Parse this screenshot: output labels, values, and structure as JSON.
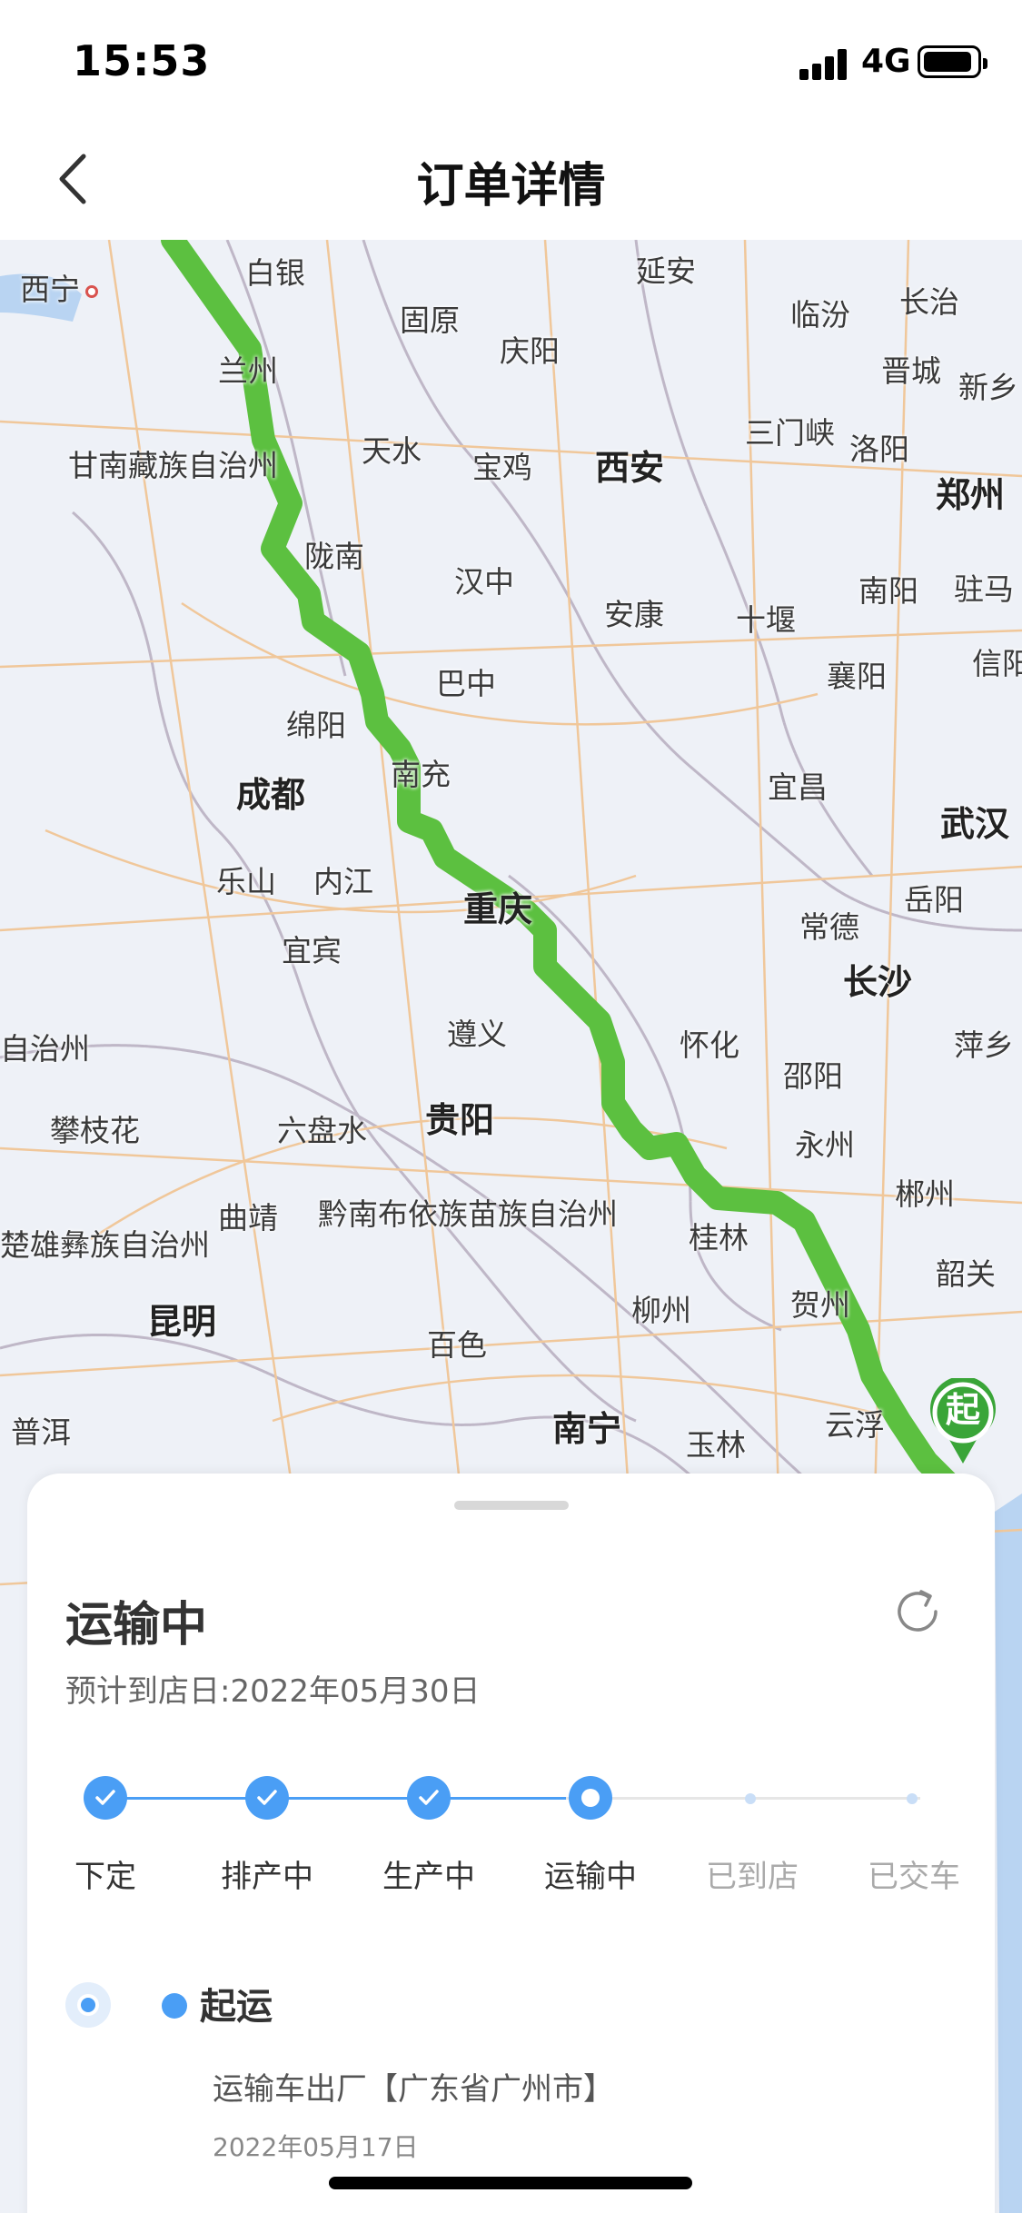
{
  "status_bar": {
    "time": "15:53",
    "network": "4G"
  },
  "nav": {
    "title": "订单详情",
    "back_icon": "chevron-left-icon"
  },
  "map": {
    "route_color": "#5cc040",
    "cities": [
      {
        "name": "西宁",
        "big": false
      },
      {
        "name": "白银",
        "big": false
      },
      {
        "name": "兰州",
        "big": false
      },
      {
        "name": "甘南藏族自治州",
        "big": false
      },
      {
        "name": "固原",
        "big": false
      },
      {
        "name": "庆阳",
        "big": false
      },
      {
        "name": "延安",
        "big": false
      },
      {
        "name": "临汾",
        "big": false
      },
      {
        "name": "长治",
        "big": false
      },
      {
        "name": "晋城",
        "big": false
      },
      {
        "name": "新乡",
        "big": false
      },
      {
        "name": "天水",
        "big": false
      },
      {
        "name": "宝鸡",
        "big": false
      },
      {
        "name": "西安",
        "big": true
      },
      {
        "name": "三门峡",
        "big": false
      },
      {
        "name": "洛阳",
        "big": false
      },
      {
        "name": "郑州",
        "big": true
      },
      {
        "name": "陇南",
        "big": false
      },
      {
        "name": "汉中",
        "big": false
      },
      {
        "name": "安康",
        "big": false
      },
      {
        "name": "十堰",
        "big": false
      },
      {
        "name": "南阳",
        "big": false
      },
      {
        "name": "驻马",
        "big": false
      },
      {
        "name": "信阳",
        "big": false
      },
      {
        "name": "巴中",
        "big": false
      },
      {
        "name": "襄阳",
        "big": false
      },
      {
        "name": "绵阳",
        "big": false
      },
      {
        "name": "成都",
        "big": true
      },
      {
        "name": "南充",
        "big": false
      },
      {
        "name": "宜昌",
        "big": false
      },
      {
        "name": "武汉",
        "big": true
      },
      {
        "name": "乐山",
        "big": false
      },
      {
        "name": "内江",
        "big": false
      },
      {
        "name": "重庆",
        "big": true
      },
      {
        "name": "常德",
        "big": false
      },
      {
        "name": "岳阳",
        "big": false
      },
      {
        "name": "宜宾",
        "big": false
      },
      {
        "name": "长沙",
        "big": true
      },
      {
        "name": "萍乡",
        "big": false
      },
      {
        "name": "遵义",
        "big": false
      },
      {
        "name": "怀化",
        "big": false
      },
      {
        "name": "邵阳",
        "big": false
      },
      {
        "name": "自治州",
        "big": false
      },
      {
        "name": "攀枝花",
        "big": false
      },
      {
        "name": "六盘水",
        "big": false
      },
      {
        "name": "贵阳",
        "big": true
      },
      {
        "name": "永州",
        "big": false
      },
      {
        "name": "郴州",
        "big": false
      },
      {
        "name": "楚雄彝族自治州",
        "big": false
      },
      {
        "name": "曲靖",
        "big": false
      },
      {
        "name": "黔南布依族苗族自治州",
        "big": false
      },
      {
        "name": "桂林",
        "big": false
      },
      {
        "name": "韶关",
        "big": false
      },
      {
        "name": "昆明",
        "big": true
      },
      {
        "name": "柳州",
        "big": false
      },
      {
        "name": "贺州",
        "big": false
      },
      {
        "name": "百色",
        "big": false
      },
      {
        "name": "普洱",
        "big": false
      },
      {
        "name": "南宁",
        "big": true
      },
      {
        "name": "玉林",
        "big": false
      },
      {
        "name": "云浮",
        "big": false
      }
    ],
    "start_pin_label": "起"
  },
  "order": {
    "status_title": "运输中",
    "eta_text": "预计到店日:2022年05月30日",
    "steps": [
      {
        "label": "下定",
        "state": "done"
      },
      {
        "label": "排产中",
        "state": "done"
      },
      {
        "label": "生产中",
        "state": "done"
      },
      {
        "label": "运输中",
        "state": "current"
      },
      {
        "label": "已到店",
        "state": "pending"
      },
      {
        "label": "已交车",
        "state": "pending"
      }
    ],
    "event": {
      "title": "起运",
      "description": "运输车出厂【广东省广州市】",
      "date": "2022年05月17日"
    }
  }
}
